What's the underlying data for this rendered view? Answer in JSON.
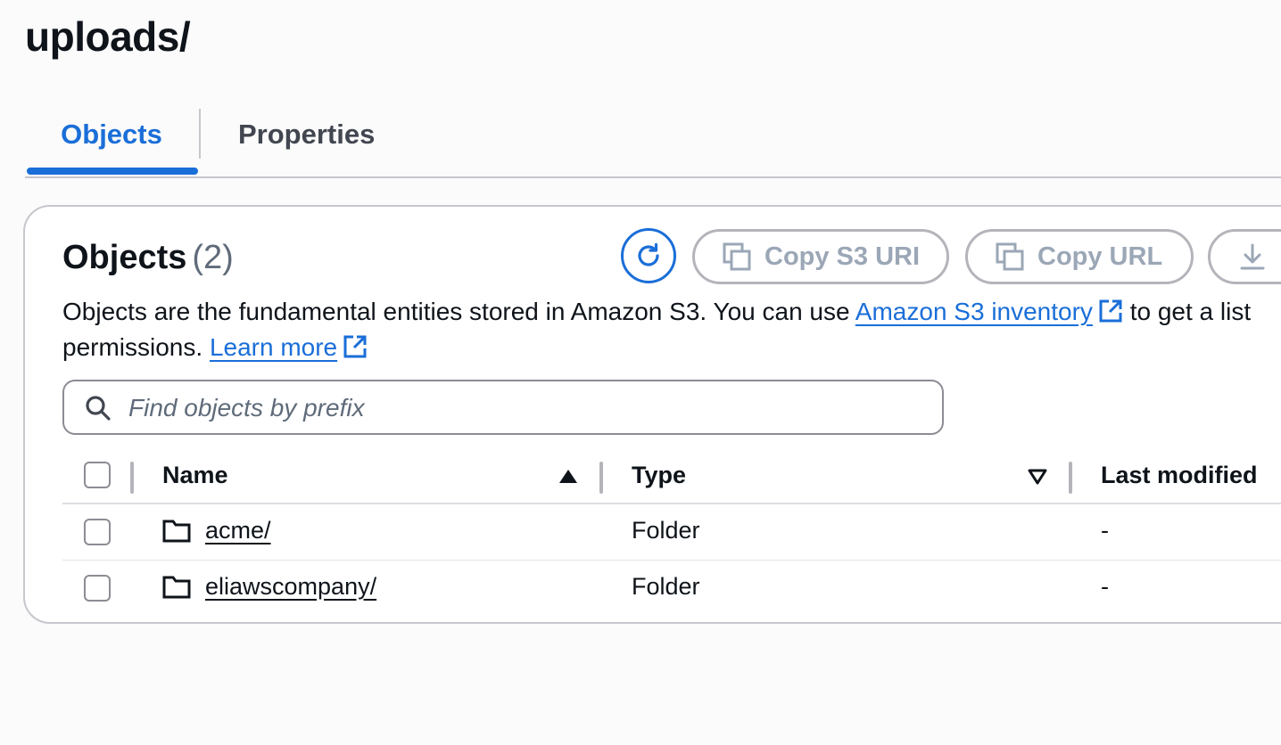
{
  "page": {
    "title": "uploads/"
  },
  "tabs": [
    {
      "label": "Objects",
      "active": true
    },
    {
      "label": "Properties",
      "active": false
    }
  ],
  "objects_panel": {
    "title": "Objects",
    "count": "(2)",
    "buttons": {
      "refresh_icon": "refresh-icon",
      "copy_s3_uri": "Copy S3 URI",
      "copy_url": "Copy URL",
      "download_icon": "download-icon"
    },
    "description": {
      "part1": "Objects are the fundamental entities stored in Amazon S3. You can use ",
      "inventory_link": "Amazon S3 inventory",
      "part2": " to get a list",
      "part3": "permissions. ",
      "learn_more_link": "Learn more"
    },
    "search": {
      "placeholder": "Find objects by prefix",
      "value": ""
    }
  },
  "table": {
    "columns": [
      "Name",
      "Type",
      "Last modified"
    ],
    "rows": [
      {
        "name": "acme/",
        "type": "Folder",
        "last_modified": "-"
      },
      {
        "name": "eliawscompany/",
        "type": "Folder",
        "last_modified": "-"
      }
    ]
  },
  "colors": {
    "accent": "#1a6ed8",
    "disabled_text": "#9ba7b6",
    "border": "#c6c6cd"
  }
}
